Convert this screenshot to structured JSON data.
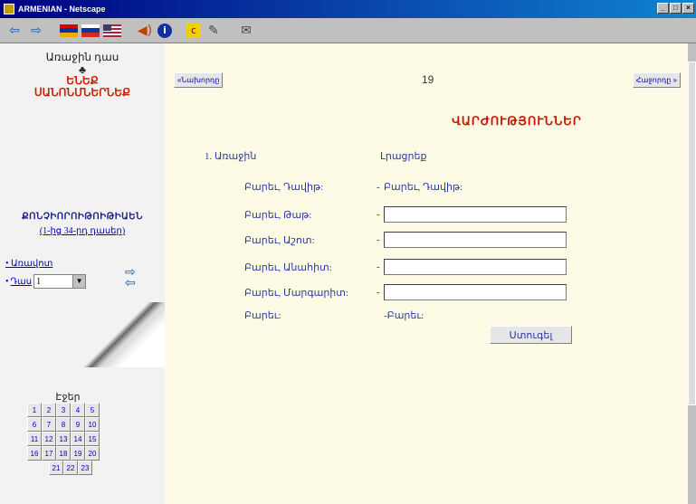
{
  "window": {
    "title": "ARMENIAN - Netscape",
    "controls": [
      "_",
      "□",
      "×"
    ]
  },
  "toolbar": {
    "icons": [
      "back-arrow-icon",
      "forward-arrow-icon",
      "armenian-flag-icon",
      "russian-flag-icon",
      "us-flag-icon",
      "sound-icon",
      "info-icon",
      "c-icon",
      "edit-icon",
      "help-icon"
    ]
  },
  "sidebar": {
    "title": "Առաջին դաս",
    "arrow": "♣",
    "subtitle_line1": "ԵՆԵՔ",
    "subtitle_line2": "ՍԱՆՈՆՄՆԵՐՆԵՔ",
    "section_title": "ՔՈՆՉԻՈՐՈԻԹՈԻԹԻԱԵՆ",
    "section_link": "(1-ից 34-րդ դասեր)",
    "link1": "Առավոտ",
    "link2": "Դաս",
    "select_value": "1",
    "calendar_title": "Էջեր",
    "calendar": [
      [
        "1",
        "2",
        "3",
        "4",
        "5"
      ],
      [
        "6",
        "7",
        "8",
        "9",
        "10"
      ],
      [
        "11",
        "12",
        "13",
        "14",
        "15"
      ],
      [
        "16",
        "17",
        "18",
        "19",
        "20"
      ],
      [
        "21",
        "22",
        "23"
      ]
    ]
  },
  "main": {
    "prev_label": "«Նախորդը",
    "next_label": "Հաջորդը »",
    "page_number": "19",
    "heading": "ՎԱՐԺՈՒԹՅՈՒՆՆԵՐ",
    "question_label": "1. Առաջին",
    "question_answer": "Լրացրեք",
    "rows": [
      {
        "label": "Բարեւ, Դավիթ:",
        "dash": "-",
        "value": "Բարեւ, Դավիթ:",
        "has_input": false
      },
      {
        "label": "Բարեւ, Թաթ:",
        "dash": "-",
        "value": "",
        "has_input": true
      },
      {
        "label": "Բարեւ, Աշոտ:",
        "dash": "-",
        "value": "",
        "has_input": true
      },
      {
        "label": "Բարեւ, Անահիտ:",
        "dash": "-",
        "value": "",
        "has_input": true
      },
      {
        "label": "Բարեւ, Մարգարիտ:",
        "dash": "-",
        "value": "",
        "has_input": true
      },
      {
        "label": "Բարեւ:",
        "dash": "",
        "value": "-Բարեւ:",
        "has_input": false
      }
    ],
    "submit_label": "Ստուգել"
  },
  "colors": {
    "heading": "#cc1100",
    "text": "#2a3aa0",
    "main_bg": "#fdfbe6",
    "sidebar_bg": "#f2f2f2"
  }
}
